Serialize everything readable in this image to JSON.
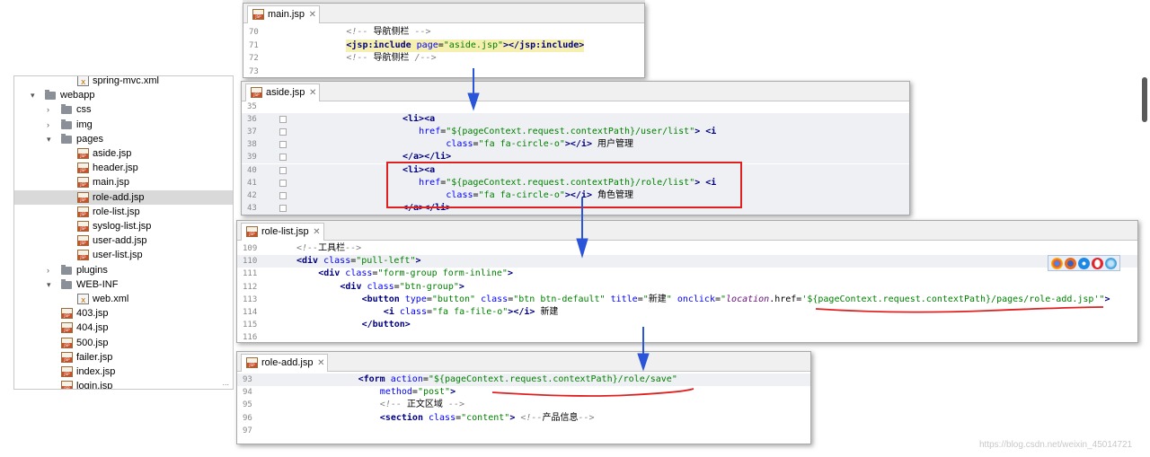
{
  "tree": {
    "items": [
      {
        "label": "spring-mvc.xml",
        "type": "xml",
        "depth": 3,
        "chevron": "none"
      },
      {
        "label": "webapp",
        "type": "folder",
        "depth": 1,
        "chevron": "down"
      },
      {
        "label": "css",
        "type": "folder",
        "depth": 2,
        "chevron": "right"
      },
      {
        "label": "img",
        "type": "folder",
        "depth": 2,
        "chevron": "right"
      },
      {
        "label": "pages",
        "type": "folder",
        "depth": 2,
        "chevron": "down"
      },
      {
        "label": "aside.jsp",
        "type": "jsp",
        "depth": 3,
        "chevron": "none"
      },
      {
        "label": "header.jsp",
        "type": "jsp",
        "depth": 3,
        "chevron": "none"
      },
      {
        "label": "main.jsp",
        "type": "jsp",
        "depth": 3,
        "chevron": "none"
      },
      {
        "label": "role-add.jsp",
        "type": "jsp",
        "depth": 3,
        "chevron": "none",
        "selected": true
      },
      {
        "label": "role-list.jsp",
        "type": "jsp",
        "depth": 3,
        "chevron": "none"
      },
      {
        "label": "syslog-list.jsp",
        "type": "jsp",
        "depth": 3,
        "chevron": "none"
      },
      {
        "label": "user-add.jsp",
        "type": "jsp",
        "depth": 3,
        "chevron": "none"
      },
      {
        "label": "user-list.jsp",
        "type": "jsp",
        "depth": 3,
        "chevron": "none"
      },
      {
        "label": "plugins",
        "type": "folder",
        "depth": 2,
        "chevron": "right"
      },
      {
        "label": "WEB-INF",
        "type": "folder",
        "depth": 2,
        "chevron": "down"
      },
      {
        "label": "web.xml",
        "type": "xml",
        "depth": 3,
        "chevron": "none"
      },
      {
        "label": "403.jsp",
        "type": "jsp",
        "depth": 2,
        "chevron": "none"
      },
      {
        "label": "404.jsp",
        "type": "jsp",
        "depth": 2,
        "chevron": "none"
      },
      {
        "label": "500.jsp",
        "type": "jsp",
        "depth": 2,
        "chevron": "none"
      },
      {
        "label": "failer.jsp",
        "type": "jsp",
        "depth": 2,
        "chevron": "none"
      },
      {
        "label": "index.jsp",
        "type": "jsp",
        "depth": 2,
        "chevron": "none"
      },
      {
        "label": "login.jsp",
        "type": "jsp",
        "depth": 2,
        "chevron": "none"
      }
    ],
    "dots": "..."
  },
  "editors": [
    {
      "id": "main",
      "tab": "main.jsp",
      "close": "✕",
      "lines": [
        {
          "n": "70",
          "indent": 8,
          "parts": [
            [
              "c",
              "<!-- "
            ],
            [
              "cn",
              "导航侧栏"
            ],
            [
              "c",
              " -->"
            ]
          ]
        },
        {
          "n": "71",
          "indent": 8,
          "mark": true,
          "parts": [
            [
              "t",
              "<jsp:include"
            ],
            [
              "a",
              " page"
            ],
            [
              "p",
              "="
            ],
            [
              "v",
              "\"aside.jsp\""
            ],
            [
              "t",
              "></jsp:include>"
            ]
          ]
        },
        {
          "n": "72",
          "indent": 8,
          "parts": [
            [
              "c",
              "<!-- "
            ],
            [
              "cn",
              "导航侧栏"
            ],
            [
              "c",
              " /-->"
            ]
          ]
        },
        {
          "n": "73",
          "indent": 0,
          "parts": []
        }
      ]
    },
    {
      "id": "aside",
      "tab": "aside.jsp",
      "close": "✕",
      "lines": [
        {
          "n": "35",
          "indent": 0,
          "parts": []
        },
        {
          "n": "36",
          "indent": 20,
          "hl": true,
          "parts": [
            [
              "t",
              "<li><a"
            ]
          ]
        },
        {
          "n": "37",
          "indent": 23,
          "hl": true,
          "parts": [
            [
              "a",
              "href"
            ],
            [
              "p",
              "="
            ],
            [
              "v",
              "\"${pageContext.request.contextPath}/user/list\""
            ],
            [
              "t",
              ">"
            ],
            [
              "p",
              " "
            ],
            [
              "t",
              "<i"
            ]
          ]
        },
        {
          "n": "38",
          "indent": 28,
          "hl": true,
          "parts": [
            [
              "a",
              "class"
            ],
            [
              "p",
              "="
            ],
            [
              "v",
              "\"fa fa-circle-o\""
            ],
            [
              "t",
              "></i>"
            ],
            [
              "p",
              " "
            ],
            [
              "cn",
              "用户管理"
            ]
          ]
        },
        {
          "n": "39",
          "indent": 20,
          "hl": true,
          "parts": [
            [
              "t",
              "</a></li>"
            ]
          ]
        },
        {
          "n": "40",
          "indent": 20,
          "hl": true,
          "parts": [
            [
              "t",
              "<li><a"
            ]
          ]
        },
        {
          "n": "41",
          "indent": 23,
          "hl": true,
          "parts": [
            [
              "a",
              "href"
            ],
            [
              "p",
              "="
            ],
            [
              "v",
              "\"${pageContext.request.contextPath}/role/list\""
            ],
            [
              "t",
              ">"
            ],
            [
              "p",
              " "
            ],
            [
              "t",
              "<i"
            ]
          ]
        },
        {
          "n": "42",
          "indent": 28,
          "hl": true,
          "parts": [
            [
              "a",
              "class"
            ],
            [
              "p",
              "="
            ],
            [
              "v",
              "\"fa fa-circle-o\""
            ],
            [
              "t",
              "></i>"
            ],
            [
              "p",
              " "
            ],
            [
              "cn",
              "角色管理"
            ]
          ]
        },
        {
          "n": "43",
          "indent": 20,
          "hl": true,
          "parts": [
            [
              "t",
              "</a></li>"
            ]
          ]
        }
      ]
    },
    {
      "id": "rolelist",
      "tab": "role-list.jsp",
      "close": "✕",
      "lines": [
        {
          "n": "109",
          "indent": 0,
          "parts": [
            [
              "c",
              "<!--"
            ],
            [
              "cn",
              "工具栏"
            ],
            [
              "c",
              "-->"
            ]
          ]
        },
        {
          "n": "110",
          "indent": 0,
          "hl": true,
          "parts": [
            [
              "t",
              "<div"
            ],
            [
              "a",
              " class"
            ],
            [
              "p",
              "="
            ],
            [
              "v",
              "\"pull-left\""
            ],
            [
              "t",
              ">"
            ]
          ]
        },
        {
          "n": "111",
          "indent": 4,
          "parts": [
            [
              "t",
              "<div"
            ],
            [
              "a",
              " class"
            ],
            [
              "p",
              "="
            ],
            [
              "v",
              "\"form-group form-inline\""
            ],
            [
              "t",
              ">"
            ]
          ]
        },
        {
          "n": "112",
          "indent": 8,
          "parts": [
            [
              "t",
              "<div"
            ],
            [
              "a",
              " class"
            ],
            [
              "p",
              "="
            ],
            [
              "v",
              "\"btn-group\""
            ],
            [
              "t",
              ">"
            ]
          ]
        },
        {
          "n": "113",
          "indent": 12,
          "parts": [
            [
              "t",
              "<button"
            ],
            [
              "a",
              " type"
            ],
            [
              "p",
              "="
            ],
            [
              "v",
              "\"button\""
            ],
            [
              "a",
              " class"
            ],
            [
              "p",
              "="
            ],
            [
              "v",
              "\"btn btn-default\""
            ],
            [
              "a",
              " title"
            ],
            [
              "p",
              "="
            ],
            [
              "v",
              "\""
            ],
            [
              "cn",
              "新建"
            ],
            [
              "v",
              "\""
            ],
            [
              "a",
              " onclick"
            ],
            [
              "p",
              "="
            ],
            [
              "v",
              "\""
            ],
            [
              "kw",
              "location"
            ],
            [
              "p",
              ".href="
            ],
            [
              "v",
              "'${pageContext.request.contextPath}/pages/role-add.jsp'\""
            ],
            [
              "t",
              ">"
            ]
          ]
        },
        {
          "n": "114",
          "indent": 16,
          "parts": [
            [
              "t",
              "<i"
            ],
            [
              "a",
              " class"
            ],
            [
              "p",
              "="
            ],
            [
              "v",
              "\"fa fa-file-o\""
            ],
            [
              "t",
              "></i>"
            ],
            [
              "p",
              " "
            ],
            [
              "cn",
              "新建"
            ]
          ]
        },
        {
          "n": "115",
          "indent": 12,
          "parts": [
            [
              "t",
              "</button>"
            ]
          ]
        },
        {
          "n": "116",
          "indent": 0,
          "parts": []
        }
      ]
    },
    {
      "id": "roleadd",
      "tab": "role-add.jsp",
      "close": "✕",
      "lines": [
        {
          "n": "93",
          "indent": 12,
          "hl": true,
          "parts": [
            [
              "t",
              "<form"
            ],
            [
              "a",
              " action"
            ],
            [
              "p",
              "="
            ],
            [
              "v",
              "\"${pageContext.request.contextPath}/role/save\""
            ]
          ]
        },
        {
          "n": "94",
          "indent": 16,
          "parts": [
            [
              "a",
              "method"
            ],
            [
              "p",
              "="
            ],
            [
              "v",
              "\"post\""
            ],
            [
              "t",
              ">"
            ]
          ]
        },
        {
          "n": "95",
          "indent": 16,
          "parts": [
            [
              "c",
              "<!-- "
            ],
            [
              "cn",
              "正文区域"
            ],
            [
              "c",
              " -->"
            ]
          ]
        },
        {
          "n": "96",
          "indent": 16,
          "parts": [
            [
              "t",
              "<section"
            ],
            [
              "a",
              " class"
            ],
            [
              "p",
              "="
            ],
            [
              "v",
              "\"content\""
            ],
            [
              "t",
              ">"
            ],
            [
              "p",
              " "
            ],
            [
              "c",
              "<!--"
            ],
            [
              "cn",
              "产品信息"
            ],
            [
              "c",
              "-->"
            ]
          ]
        },
        {
          "n": "97",
          "indent": 0,
          "parts": []
        }
      ]
    }
  ],
  "watermark": "https://blog.csdn.net/weixin_45014721",
  "colors": {
    "annotation_red": "#e02020",
    "arrow_blue": "#2a55d8"
  }
}
